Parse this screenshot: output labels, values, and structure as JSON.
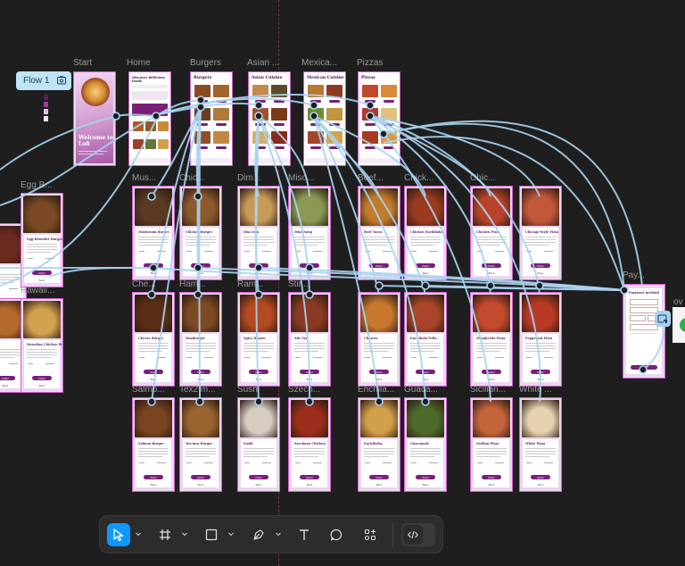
{
  "canvas": {
    "flow_tag": {
      "label": "Flow 1",
      "icon": "play-flow-icon"
    },
    "frame_labels": {
      "start": "Start",
      "home": "Home",
      "burgers": "Burgers",
      "asian": "Asian ...",
      "mexican": "Mexica...",
      "pizzas": "Pizzas",
      "egg": "Egg B...",
      "hawaii": "Hawaii...",
      "mush": "Mus...",
      "chick": "Chic...",
      "dim": "Dim...",
      "miso": "Miso...",
      "beef": "Beef...",
      "chicken2": "Chick...",
      "chick3": "Chic...",
      "cheese": "Che...",
      "ham": "Ham...",
      "ramen": "Ram...",
      "stir": "Stir...",
      "salmon": "Salmo...",
      "texmex": "Tex2 m...",
      "sushi": "Sushi",
      "szech": "Szech...",
      "enchi": "Enchila...",
      "guac": "Guaca...",
      "sicil": "Sicilian...",
      "white": "White ...",
      "pay": "Pay..."
    },
    "start_screen": {
      "title": "Welcome to Lofi"
    },
    "home_screen": {
      "title": "Discover delicious foods"
    },
    "category_screens": {
      "burgers": "Burgers",
      "asian": "Asian Cuisine",
      "mexican": "Mexican Cuisine",
      "pizzas": "Pizzas"
    },
    "dish_titles": {
      "egg": "Egg-Benedict Burger",
      "hawaii": "Hawaiian Chicken Pizza",
      "mush": "Mushroom Burger",
      "chick": "Chicken Burger",
      "dim": "Dim Sum",
      "miso": "Miso Soup",
      "beef": "Beef Tacos",
      "chicken2": "Chicken Enchiladas",
      "chick3": "Chicken Pizza",
      "chicken4": "Chicago-Style Pizza",
      "cheese": "Cheese Burger",
      "ham": "Hamburger",
      "ramen": "Spicy Ramen",
      "stir": "Stir Fry",
      "churros": "Churros",
      "pollo": "Enchilada Pollo",
      "marg": "Margherita Pizza",
      "pepp": "Pepperoni Pizza",
      "salmon": "Salmon Burger",
      "texmex": "Tex-mex Burger",
      "sushi": "Sushi",
      "szech": "Szechuan Chicken",
      "enchi": "Enchiladas",
      "guac": "Guacamole",
      "sicil": "Sicilian Pizza",
      "white": "White Pizza"
    },
    "dish_buttons": {
      "order": "Order",
      "back": "Back"
    },
    "payment": {
      "title": "Payment method"
    }
  },
  "toolbar": {
    "tools": [
      {
        "name": "move-tool",
        "icon": "cursor-arrow-icon",
        "active": true
      },
      {
        "name": "frame-tool",
        "icon": "frame-hash-icon",
        "active": false
      },
      {
        "name": "shape-tool",
        "icon": "rectangle-icon",
        "active": false
      },
      {
        "name": "pen-tool",
        "icon": "pen-nib-icon",
        "active": false
      },
      {
        "name": "text-tool",
        "icon": "text-T-icon",
        "active": false
      },
      {
        "name": "comment-tool",
        "icon": "comment-bubble-icon",
        "active": false
      },
      {
        "name": "actions-tool",
        "icon": "actions-grid-icon",
        "active": false
      }
    ],
    "dev_mode_icon": "code-brackets-icon",
    "accent": "#0d99ff"
  },
  "colors": {
    "canvas_bg": "#1e1e1e",
    "frame_border": "#d35fd3",
    "frame_fill": "#ecd7ee",
    "prototype_link": "#a8d3f0",
    "brand_purple": "#7b1e7a"
  }
}
